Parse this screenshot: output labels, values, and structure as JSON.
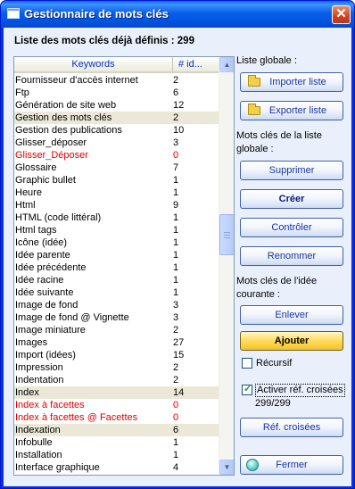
{
  "window": {
    "title": "Gestionnaire de mots clés",
    "close_glyph": "✕"
  },
  "header": {
    "label": "Liste des mots clés déjà définis : 299"
  },
  "list": {
    "columns": [
      "Keywords",
      "# id..."
    ],
    "rows": [
      {
        "k": "Fournisseur d'accès internet",
        "n": "2",
        "style": ""
      },
      {
        "k": "Ftp",
        "n": "6",
        "style": ""
      },
      {
        "k": "Génération de site web",
        "n": "12",
        "style": ""
      },
      {
        "k": "Gestion des mots clés",
        "n": "2",
        "style": "hl"
      },
      {
        "k": "Gestion des publications",
        "n": "10",
        "style": ""
      },
      {
        "k": "Glisser_déposer",
        "n": "3",
        "style": ""
      },
      {
        "k": "Glisser_Déposer",
        "n": "0",
        "style": "red"
      },
      {
        "k": "Glossaire",
        "n": "7",
        "style": ""
      },
      {
        "k": "Graphic bullet",
        "n": "1",
        "style": ""
      },
      {
        "k": "Heure",
        "n": "1",
        "style": ""
      },
      {
        "k": "Html",
        "n": "9",
        "style": ""
      },
      {
        "k": "HTML (code littéral)",
        "n": "1",
        "style": ""
      },
      {
        "k": "Html tags",
        "n": "1",
        "style": ""
      },
      {
        "k": "Icône (idée)",
        "n": "1",
        "style": ""
      },
      {
        "k": "Idée parente",
        "n": "1",
        "style": ""
      },
      {
        "k": "Idée précédente",
        "n": "1",
        "style": ""
      },
      {
        "k": "Idée racine",
        "n": "1",
        "style": ""
      },
      {
        "k": "Idée suivante",
        "n": "1",
        "style": ""
      },
      {
        "k": "Image de fond",
        "n": "3",
        "style": ""
      },
      {
        "k": "Image de fond @ Vignette",
        "n": "3",
        "style": ""
      },
      {
        "k": "Image miniature",
        "n": "2",
        "style": ""
      },
      {
        "k": "Images",
        "n": "27",
        "style": ""
      },
      {
        "k": "Import (idées)",
        "n": "15",
        "style": ""
      },
      {
        "k": "Impression",
        "n": "2",
        "style": ""
      },
      {
        "k": "Indentation",
        "n": "2",
        "style": ""
      },
      {
        "k": "Index",
        "n": "14",
        "style": "hl"
      },
      {
        "k": "Index à facettes",
        "n": "0",
        "style": "red"
      },
      {
        "k": "Index à facettes @ Facettes",
        "n": "0",
        "style": "red"
      },
      {
        "k": "Indexation",
        "n": "6",
        "style": "hl"
      },
      {
        "k": "Infobulle",
        "n": "1",
        "style": ""
      },
      {
        "k": "Installation",
        "n": "1",
        "style": ""
      },
      {
        "k": "Interface graphique",
        "n": "4",
        "style": ""
      }
    ]
  },
  "panel": {
    "global_label": "Liste globale :",
    "import_label": "Importer liste",
    "export_label": "Exporter liste",
    "global_kw_label_1": "Mots clés de la liste",
    "global_kw_label_2": "globale :",
    "delete_label": "Supprimer",
    "create_label": "Créer",
    "check_label": "Contrôler",
    "rename_label": "Renommer",
    "current_kw_label_1": "Mots clés de l'idée",
    "current_kw_label_2": "courante :",
    "remove_label": "Enlever",
    "add_label": "Ajouter",
    "recursive_label": "Récursif",
    "recursive_checked": false,
    "crossref_label": "Activer réf. croisées",
    "crossref_checked": true,
    "crossref_count": "299/299",
    "crossref_button": "Réf. croisées",
    "close_label": "Fermer"
  }
}
